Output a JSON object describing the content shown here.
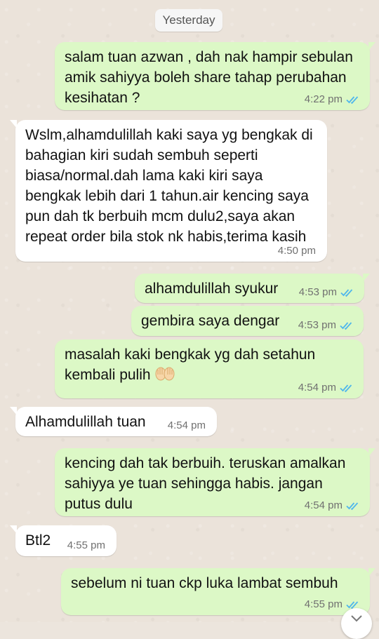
{
  "date_separator": "Yesterday",
  "messages": [
    {
      "dir": "out",
      "text": "salam tuan azwan , dah nak hampir sebulan amik sahiyya boleh share tahap perubahan kesihatan ?",
      "time": "4:22 pm",
      "status": "read"
    },
    {
      "dir": "in",
      "text": "Wslm,alhamdulillah kaki saya yg bengkak di bahagian kiri sudah sembuh seperti biasa/normal.dah lama kaki kiri saya bengkak lebih dari 1  tahun.air kencing saya pun dah tk berbuih mcm dulu2,saya akan repeat order bila stok nk habis,terima kasih",
      "time": "4:50 pm"
    },
    {
      "dir": "out",
      "text": "alhamdulillah syukur",
      "time": "4:53 pm",
      "status": "read"
    },
    {
      "dir": "out",
      "text": "gembira saya dengar",
      "time": "4:53 pm",
      "status": "read"
    },
    {
      "dir": "out",
      "text": "masalah kaki bengkak yg dah setahun kembali pulih",
      "emoji": "raising-hands-icon",
      "time": "4:54 pm",
      "status": "read"
    },
    {
      "dir": "in",
      "text": "Alhamdulillah tuan",
      "time": "4:54 pm"
    },
    {
      "dir": "out",
      "text": "kencing dah tak berbuih. teruskan amalkan sahiyya ye tuan sehingga habis. jangan putus dulu",
      "time": "4:54 pm",
      "status": "read"
    },
    {
      "dir": "in",
      "text": "Btl2",
      "time": "4:55 pm"
    },
    {
      "dir": "out",
      "text": "sebelum ni tuan ckp luka lambat sembuh",
      "time": "4:55 pm",
      "status": "read"
    }
  ],
  "colors": {
    "outgoing_bubble": "#dcf8c6",
    "incoming_bubble": "#ffffff",
    "read_ticks": "#4fb6ec",
    "wallpaper": "#ece5dd"
  },
  "icons": {
    "read_receipt": "double-check-icon",
    "scroll_down": "chevron-down-icon"
  }
}
